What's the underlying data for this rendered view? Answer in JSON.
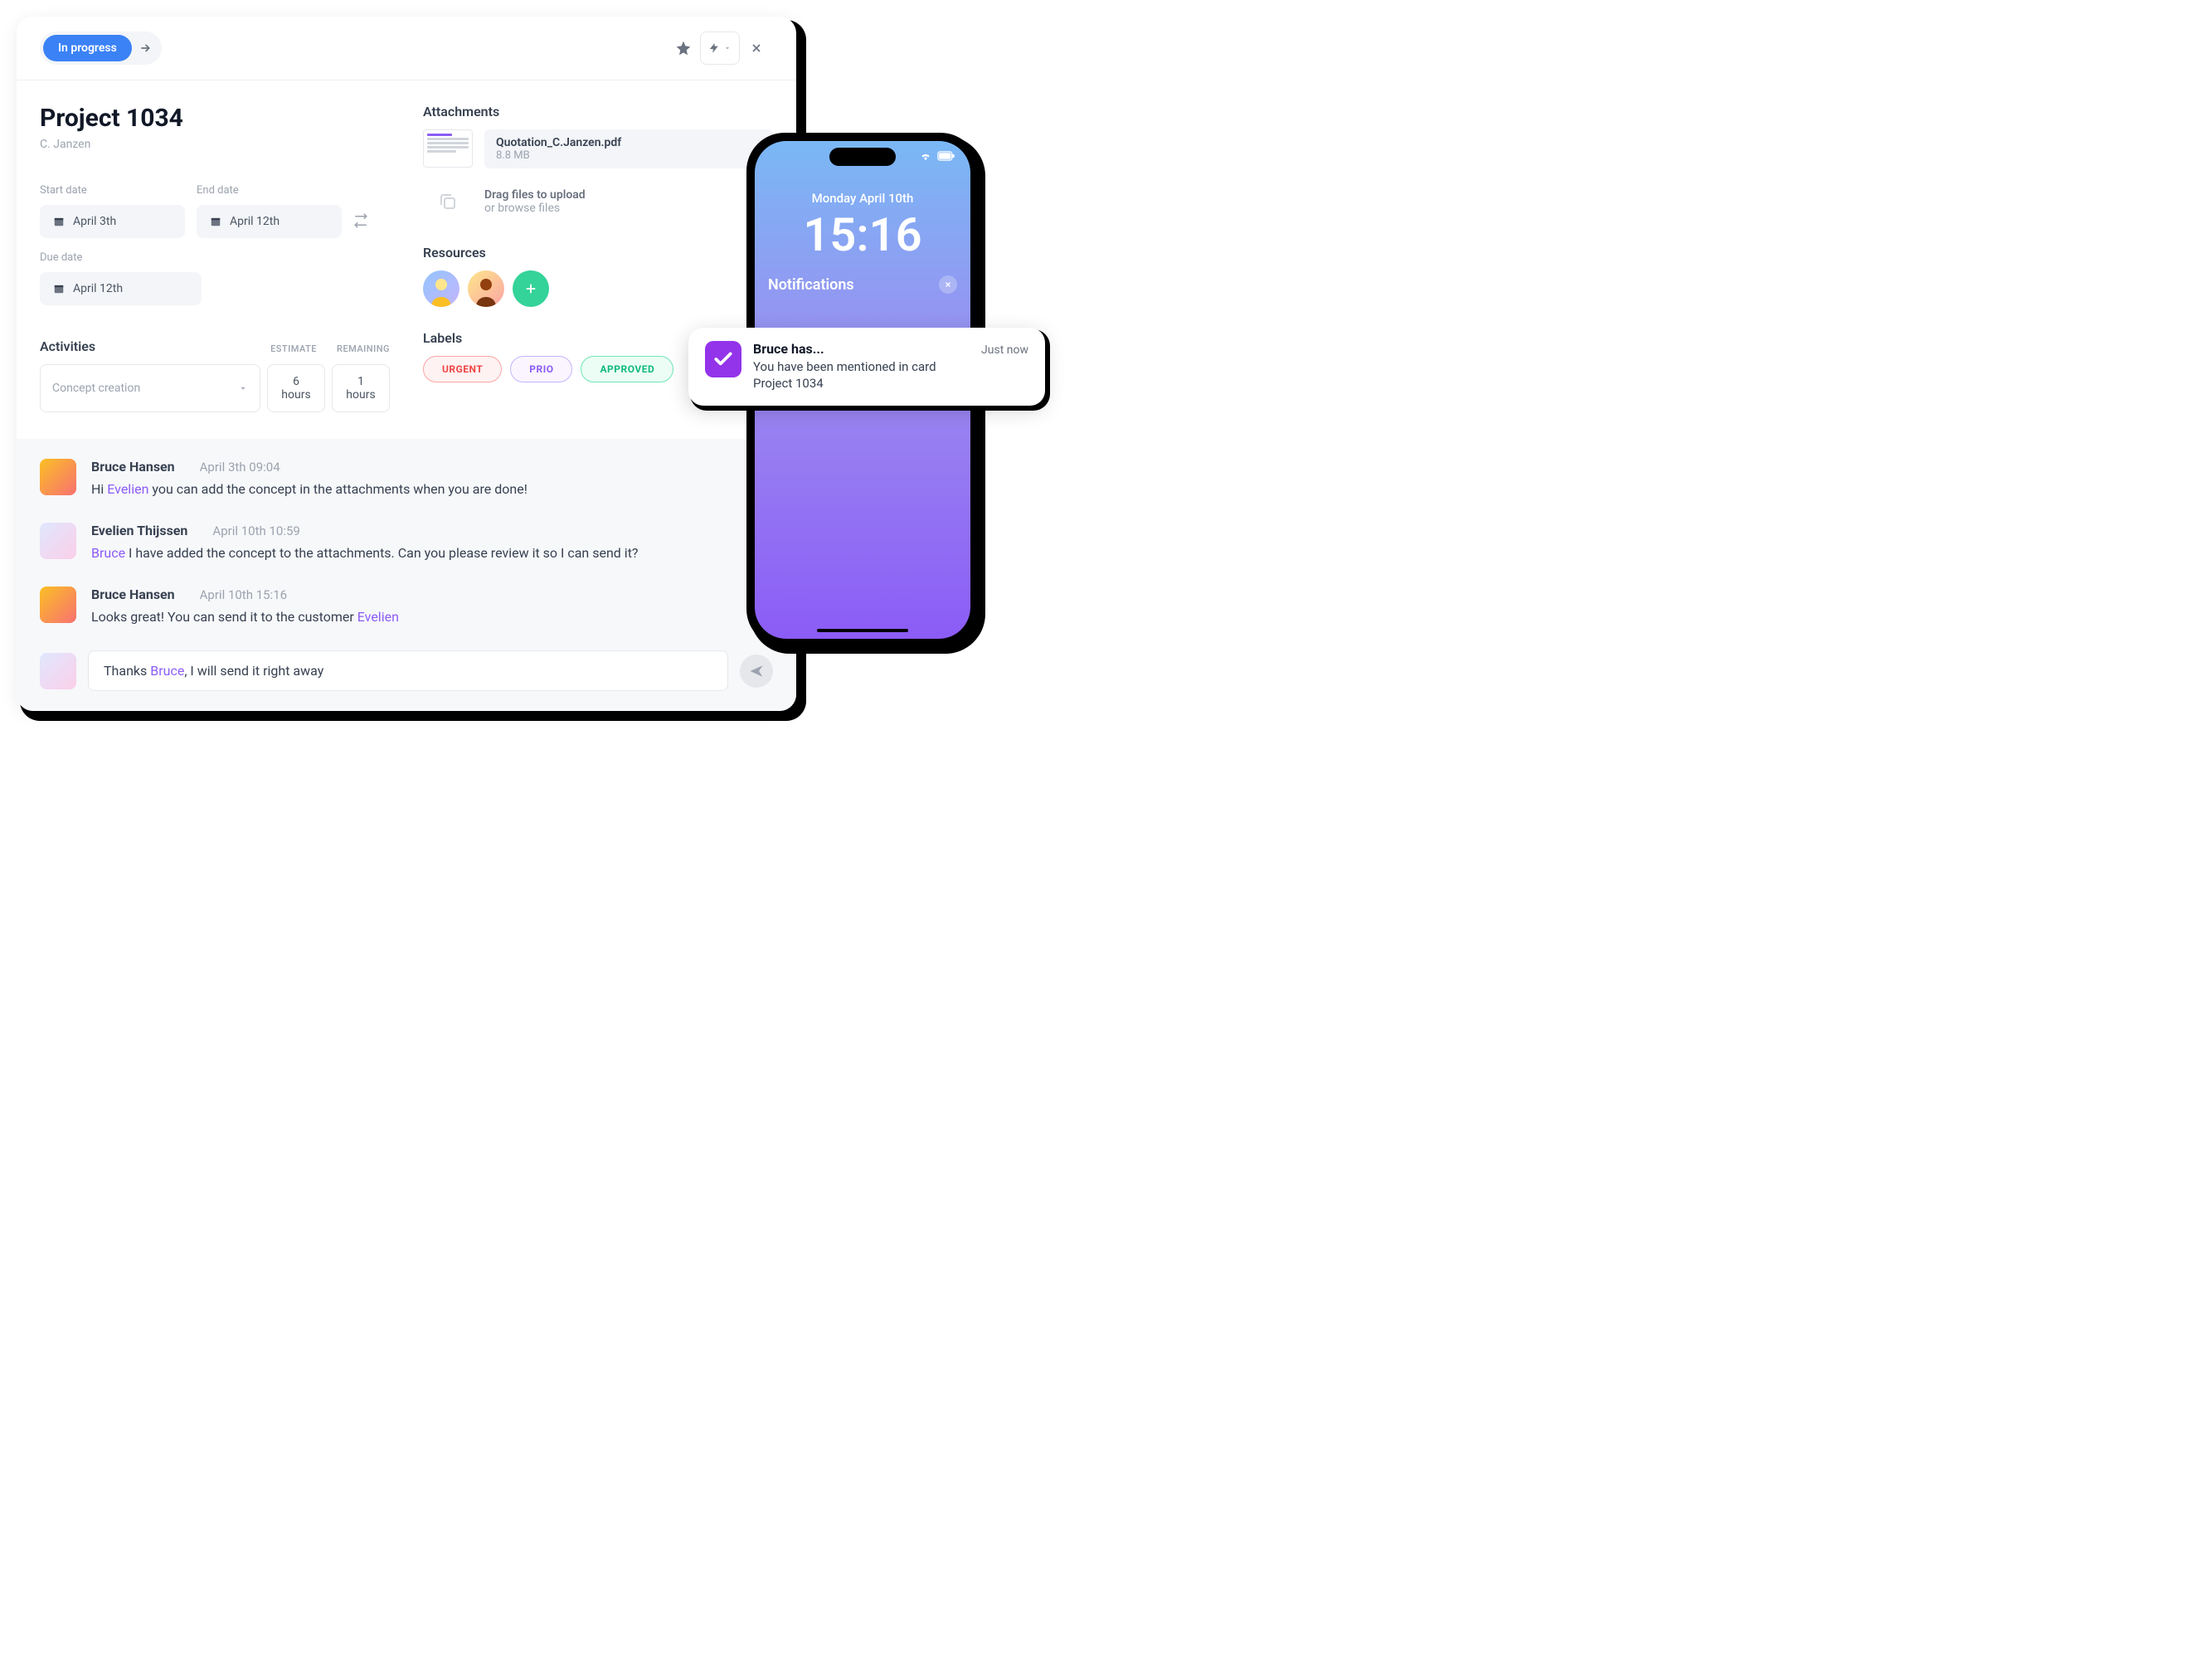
{
  "header": {
    "status_label": "In progress"
  },
  "project": {
    "title": "Project 1034",
    "author": "C. Janzen"
  },
  "dates": {
    "start_label": "Start date",
    "start_value": "April 3th",
    "end_label": "End date",
    "end_value": "April 12th",
    "due_label": "Due date",
    "due_value": "April 12th"
  },
  "activities": {
    "title": "Activities",
    "col_estimate": "ESTIMATE",
    "col_remaining": "REMAINING",
    "select_value": "Concept creation",
    "estimate_value": "6 hours",
    "remaining_value": "1 hours"
  },
  "attachments": {
    "title": "Attachments",
    "file_name": "Quotation_C.Janzen.pdf",
    "file_size": "8.8 MB",
    "upload_t1": "Drag files to upload",
    "upload_t2": "or browse files"
  },
  "resources": {
    "title": "Resources"
  },
  "labels": {
    "title": "Labels",
    "urgent": "URGENT",
    "prio": "PRIO",
    "approved": "APPROVED"
  },
  "comments": [
    {
      "author": "Bruce Hansen",
      "time": "April 3th 09:04",
      "prefix": "Hi ",
      "mention": "Evelien",
      "suffix": " you can add the concept in the attachments when you are done!"
    },
    {
      "author": "Evelien Thijssen",
      "time": "April 10th 10:59",
      "prefix": "",
      "mention": "Bruce",
      "suffix": " I have added the concept to the attachments. Can you please review it so I can send it?"
    },
    {
      "author": "Bruce Hansen",
      "time": "April 10th 15:16",
      "prefix": "Looks great! You can send it to the customer ",
      "mention": "Evelien",
      "suffix": ""
    }
  ],
  "reply": {
    "prefix": "Thanks ",
    "mention": "Bruce",
    "suffix": ", I will send it right away"
  },
  "phone": {
    "date": "Monday April 10th",
    "time": "15:16",
    "notifications_title": "Notifications"
  },
  "notification": {
    "sender": "Bruce has...",
    "when": "Just now",
    "line1": "You have been mentioned in card",
    "line2": "Project 1034"
  }
}
